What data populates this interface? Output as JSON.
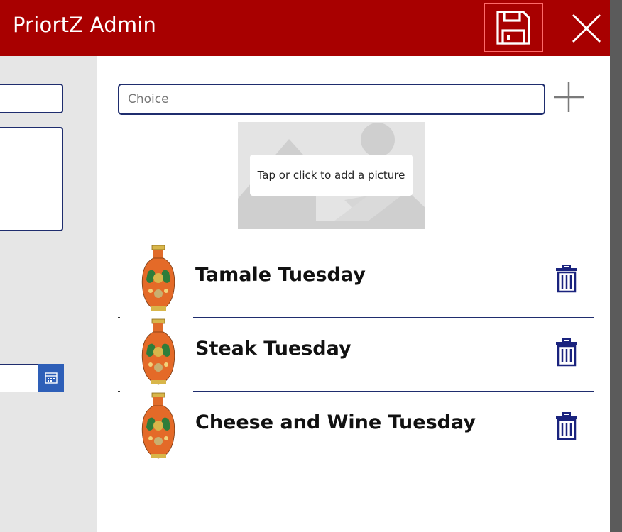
{
  "header": {
    "title": "PriortZ Admin",
    "background": "#a80000",
    "save_icon": "floppy-disk-icon",
    "close_icon": "close-icon"
  },
  "form": {
    "choice_placeholder": "Choice",
    "add_icon": "plus-icon",
    "image_placeholder_label": "Tap or click to add a picture",
    "calendar_icon": "calendar-icon"
  },
  "list": {
    "items": [
      {
        "title": "Tamale Tuesday",
        "image": "vase-image",
        "delete_icon": "trash-icon"
      },
      {
        "title": "Steak Tuesday",
        "image": "vase-image",
        "delete_icon": "trash-icon"
      },
      {
        "title": "Cheese and Wine Tuesday",
        "image": "vase-image",
        "delete_icon": "trash-icon"
      }
    ]
  },
  "colors": {
    "accent": "#a80000",
    "border": "#1f2d6e",
    "icon_blue": "#1a237e",
    "calendar_button": "#2e5fb8"
  }
}
